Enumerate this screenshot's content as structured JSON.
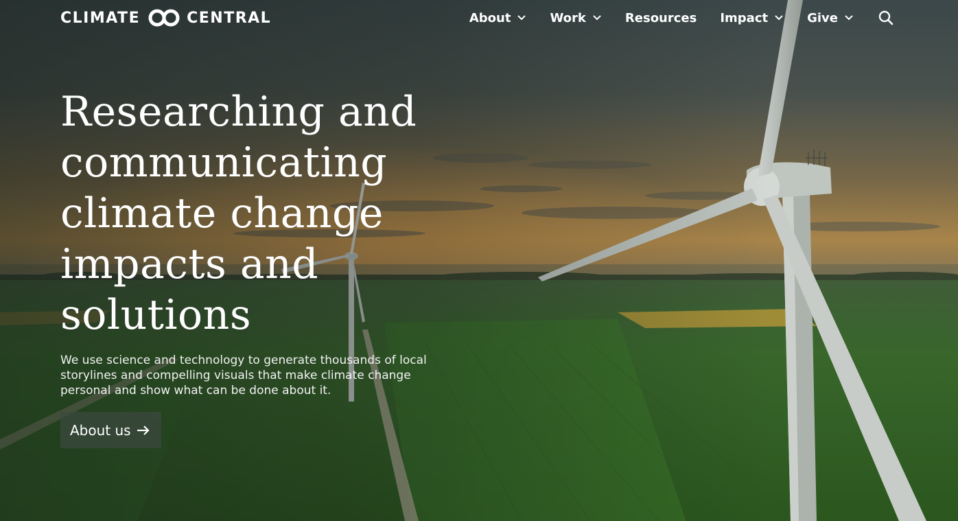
{
  "brand": {
    "name_part1": "CLIMATE",
    "name_part2": "CENTRAL",
    "logo_icon": "interlocking-circles-icon"
  },
  "nav": {
    "items": [
      {
        "label": "About",
        "has_dropdown": true
      },
      {
        "label": "Work",
        "has_dropdown": true
      },
      {
        "label": "Resources",
        "has_dropdown": false
      },
      {
        "label": "Impact",
        "has_dropdown": true
      },
      {
        "label": "Give",
        "has_dropdown": true
      }
    ],
    "search_icon": "search-icon"
  },
  "hero": {
    "headline_lines": [
      "Researching and",
      "communicating",
      "climate change",
      "impacts and",
      "solutions"
    ],
    "description": "We use science and technology to generate thousands of local storylines and compelling visuals that make climate change personal and show what can be done about it.",
    "cta_label": "About us",
    "cta_icon": "arrow-right-icon",
    "background_image": "wind-turbines-over-farmland-at-sunset"
  },
  "colors": {
    "text": "#ffffff",
    "button_bg": "#3c4840"
  }
}
